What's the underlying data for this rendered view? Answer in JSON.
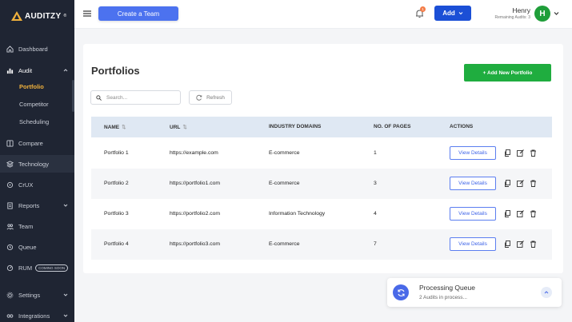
{
  "brand": {
    "name": "AUDITZY",
    "tm": "®"
  },
  "sidebar": {
    "items": [
      {
        "label": "Dashboard",
        "icon": "home-icon"
      },
      {
        "label": "Audit",
        "icon": "bar-chart-icon"
      },
      {
        "label": "Compare",
        "icon": "compare-icon"
      },
      {
        "label": "Technology",
        "icon": "layers-icon"
      },
      {
        "label": "CrUX",
        "icon": "crux-icon"
      },
      {
        "label": "Reports",
        "icon": "report-icon"
      },
      {
        "label": "Team",
        "icon": "team-icon"
      },
      {
        "label": "Queue",
        "icon": "queue-icon"
      },
      {
        "label": "RUM",
        "icon": "rum-icon",
        "badge": "COMING SOON"
      },
      {
        "label": "Settings",
        "icon": "gear-icon"
      },
      {
        "label": "Integrations",
        "icon": "integrations-icon"
      }
    ],
    "audit_sub": [
      "Portfolio",
      "Competitor",
      "Scheduling"
    ]
  },
  "header": {
    "create_team": "Create a Team",
    "notification_count": "1",
    "add_label": "Add",
    "user_name": "Henry",
    "remaining_audits": "Remaining Audits: 3",
    "avatar_initial": "H"
  },
  "main": {
    "title": "Portfolios",
    "add_button": "+ Add New Portfolio",
    "search_placeholder": "Search...",
    "refresh_label": "Refresh",
    "columns": [
      "NAME",
      "URL",
      "INDUSTRY DOMAINS",
      "NO. OF PAGES",
      "ACTIONS"
    ],
    "sort_glyph": "⇅",
    "rows": [
      {
        "name": "Portfolio 1",
        "url": "https://example.com",
        "domain": "E-commerce",
        "pages": "1",
        "action": "View Details"
      },
      {
        "name": "Portfolio 2",
        "url": "https://portfolio1.com",
        "domain": "E-commerce",
        "pages": "3",
        "action": "View Details"
      },
      {
        "name": "Portfolio 3",
        "url": "https://portfolio2.com",
        "domain": "Information Technology",
        "pages": "4",
        "action": "View Details"
      },
      {
        "name": "Portfolio 4",
        "url": "https://portfolio3.com",
        "domain": "E-commerce",
        "pages": "7",
        "action": "View Details"
      }
    ]
  },
  "queue": {
    "title": "Processing Queue",
    "status": "2 Audits in process..."
  },
  "colors": {
    "sidebar_bg": "#1f2533",
    "active_sub": "#f0b13c",
    "primary": "#1b4fd6",
    "create_team": "#4c72ef",
    "add_portfolio": "#1fad3f",
    "avatar": "#1f9e3a",
    "table_header": "#dfe8f3"
  }
}
